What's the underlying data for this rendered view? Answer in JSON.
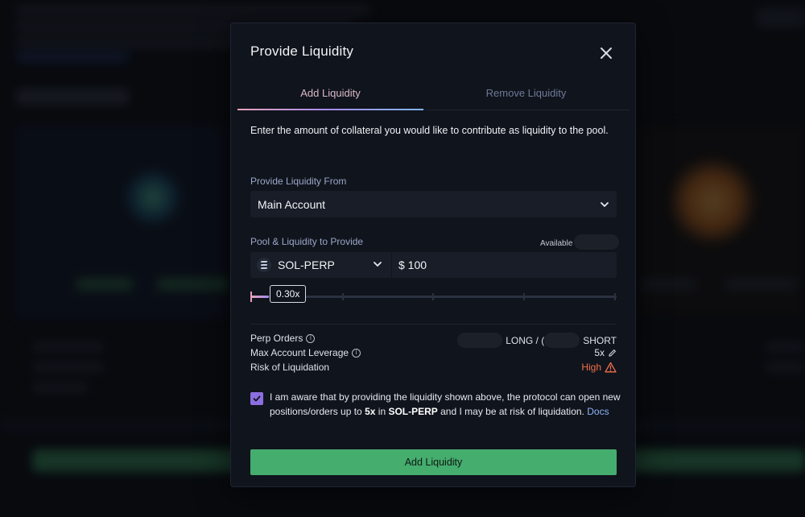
{
  "modal": {
    "title": "Provide Liquidity",
    "tabs": [
      {
        "label": "Add Liquidity",
        "active": true
      },
      {
        "label": "Remove Liquidity",
        "active": false
      }
    ],
    "description": "Enter the amount of collateral you would like to contribute as liquidity to the pool.",
    "source": {
      "label": "Provide Liquidity From",
      "selected": "Main Account"
    },
    "pool": {
      "label": "Pool & Liquidity to Provide",
      "available_label": "Available",
      "market": "SOL-PERP",
      "amount": "$ 100"
    },
    "slider": {
      "value_label": "0.30x",
      "fraction": 0.05
    },
    "stats": {
      "perp_orders_label": "Perp Orders",
      "long_label": "LONG / (",
      "short_label": "SHORT",
      "max_leverage_label": "Max Account Leverage",
      "max_leverage_value": "5x",
      "risk_label": "Risk of Liquidation",
      "risk_value": "High"
    },
    "acknowledgement": {
      "checked": true,
      "text_1": "I am aware that by providing the liquidity shown above, the protocol can open new positions/orders up to ",
      "leverage": "5x",
      "text_2": " in ",
      "market": "SOL-PERP",
      "text_3": " and I may be at risk of liquidation. ",
      "docs_link": "Docs"
    },
    "submit_label": "Add Liquidity"
  },
  "colors": {
    "accent_purple": "#8b6fe0",
    "button_green": "#45ad6e",
    "risk_high": "#f0704a",
    "link_blue": "#8cb4f5"
  },
  "icons": [
    "close-icon",
    "chevron-down-icon",
    "solana-icon",
    "info-icon",
    "pencil-icon",
    "warning-icon",
    "check-icon"
  ]
}
